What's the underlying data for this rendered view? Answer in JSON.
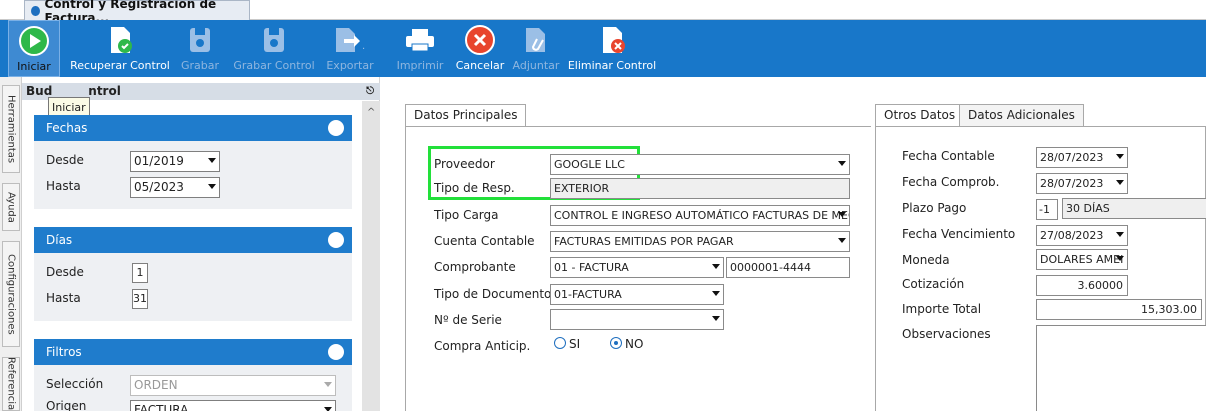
{
  "window": {
    "tab_title": "Control y Registración de Factura..."
  },
  "toolbar": {
    "buttons": [
      {
        "label": "Iniciar",
        "icon": "play-icon",
        "enabled": true
      },
      {
        "label": "Recuperar Control",
        "icon": "recover-document-icon",
        "enabled": true
      },
      {
        "label": "Grabar",
        "icon": "save-icon",
        "enabled": false
      },
      {
        "label": "Grabar Control",
        "icon": "save-control-icon",
        "enabled": false
      },
      {
        "label": "Exportar",
        "icon": "export-icon",
        "enabled": false
      },
      {
        "label": "Imprimir",
        "icon": "printer-icon",
        "enabled": false
      },
      {
        "label": "Cancelar",
        "icon": "cancel-icon",
        "enabled": true
      },
      {
        "label": "Adjuntar",
        "icon": "attach-icon",
        "enabled": false
      },
      {
        "label": "Eliminar Control",
        "icon": "delete-document-icon",
        "enabled": true
      }
    ],
    "tooltip": "Iniciar"
  },
  "side_tabs": [
    "Herramientas",
    "Ayuda",
    "Configuraciones",
    "Referencia"
  ],
  "left_panel": {
    "title_a": "Bud",
    "title_b": "ntrol",
    "fechas": {
      "title": "Fechas",
      "desde_label": "Desde",
      "desde_value": "01/2019",
      "hasta_label": "Hasta",
      "hasta_value": "05/2023"
    },
    "dias": {
      "title": "Días",
      "desde_label": "Desde",
      "desde_value": "1",
      "hasta_label": "Hasta",
      "hasta_value": "31"
    },
    "filtros": {
      "title": "Filtros",
      "seleccion_label": "Selección",
      "seleccion_value": "ORDEN",
      "origen_label": "Origen",
      "origen_value": "FACTURA"
    }
  },
  "main": {
    "tab": "Datos Principales",
    "proveedor_label": "Proveedor",
    "proveedor_value": "GOOGLE LLC",
    "tipo_resp_label": "Tipo de Resp.",
    "tipo_resp_value": "EXTERIOR",
    "tipo_carga_label": "Tipo Carga",
    "tipo_carga_value": "CONTROL E INGRESO AUTOMÁTICO FACTURAS DE MEC",
    "cuenta_label": "Cuenta Contable",
    "cuenta_value": "FACTURAS EMITIDAS POR PAGAR",
    "comprobante_label": "Comprobante",
    "comprobante_value": "01 - FACTURA",
    "comprobante_num": "0000001-4444",
    "tipo_doc_label": "Tipo de Documento",
    "tipo_doc_value": "01-FACTURA",
    "serie_label": "Nº de Serie",
    "serie_value": "",
    "compra_label": "Compra Anticip.",
    "opt_si": "SI",
    "opt_no": "NO"
  },
  "right_panel": {
    "tab_1": "Otros Datos",
    "tab_2": "Datos Adicionales",
    "fecha_contable_label": "Fecha Contable",
    "fecha_contable": "28/07/2023",
    "fecha_comprob_label": "Fecha Comprob.",
    "fecha_comprob": "28/07/2023",
    "plazo_label": "Plazo Pago",
    "plazo_num": "-1",
    "plazo_text": "30 DÍAS",
    "vencimiento_label": "Fecha Vencimiento",
    "vencimiento": "27/08/2023",
    "moneda_label": "Moneda",
    "moneda": "DOLARES AMEI",
    "cotizacion_label": "Cotización",
    "cotizacion": "3.60000",
    "importe_label": "Importe Total",
    "importe": "15,303.00",
    "obs_label": "Observaciones"
  },
  "colors": {
    "toolbar": "#1877c9",
    "group_header": "#1f7ccc",
    "highlight": "#22e03a"
  }
}
